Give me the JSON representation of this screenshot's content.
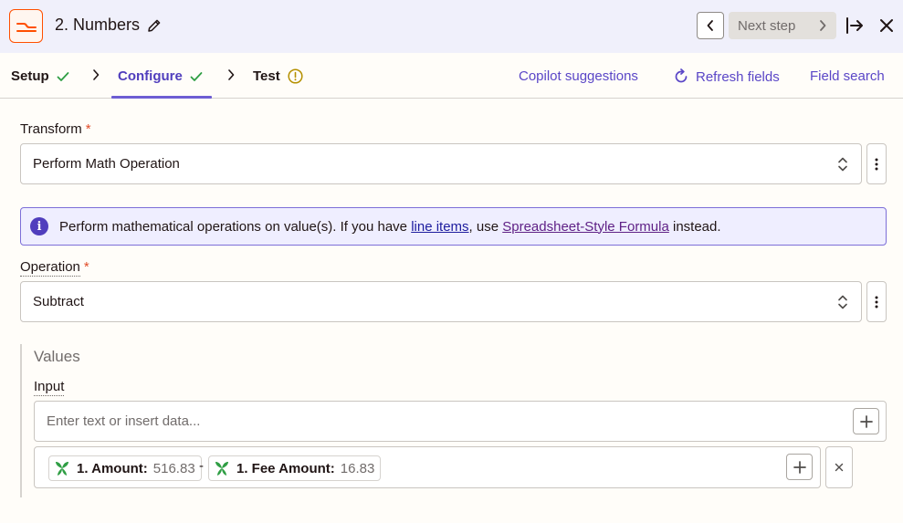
{
  "header": {
    "app_icon": "formatter-icon",
    "step_title": "2. Numbers",
    "next_step_label": "Next step"
  },
  "tabs": {
    "setup": "Setup",
    "configure": "Configure",
    "test": "Test",
    "copilot": "Copilot suggestions",
    "refresh": "Refresh fields",
    "field_search": "Field search"
  },
  "form": {
    "transform_label": "Transform",
    "transform_required": "*",
    "transform_value": "Perform Math Operation",
    "info_text_1": "Perform mathematical operations on value(s). If you have ",
    "info_link_1": "line items",
    "info_text_2": ", use ",
    "info_link_2": "Spreadsheet-Style Formula",
    "info_text_3": " instead.",
    "operation_label": "Operation",
    "operation_required": "*",
    "operation_value": "Subtract",
    "values_title": "Values",
    "input_label": "Input",
    "input_placeholder": "Enter text or insert data...",
    "pill1_label": "1. Amount:",
    "pill1_value": "516.83",
    "operator": "-",
    "pill2_label": "1. Fee Amount:",
    "pill2_value": "16.83"
  },
  "colors": {
    "accent": "#503ebd",
    "brand_orange": "#ff4f00",
    "success": "#2f9e44",
    "warning": "#b59000"
  }
}
